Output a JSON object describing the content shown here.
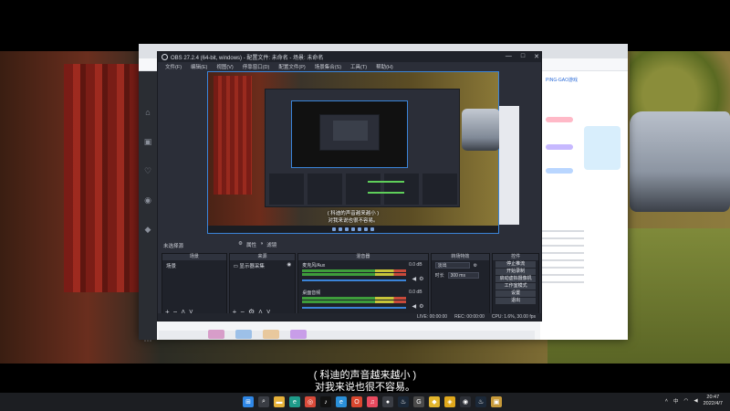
{
  "obs": {
    "title": "OBS 27.2.4 (64-bit, windows) - 配置文件: 未命名 - 场景: 未命名",
    "menu": [
      "文件(F)",
      "编辑(E)",
      "视图(V)",
      "停靠窗口(D)",
      "配置文件(P)",
      "场景集合(S)",
      "工具(T)",
      "帮助(H)"
    ],
    "window_buttons": [
      "—",
      "□",
      "✕"
    ],
    "scene_label": "未选择源",
    "scene_tools": [
      "属性",
      "滤镜"
    ],
    "docks": {
      "scenes_header": "场景",
      "scenes": [
        "场景"
      ],
      "sources_header": "来源",
      "sources": [
        "显示器采集"
      ],
      "mixer_header": "混音器",
      "mixer": [
        {
          "name": "麦克风/Aux",
          "db": "0.0 dB"
        },
        {
          "name": "桌面音频",
          "db": "0.0 dB"
        }
      ],
      "transitions_header": "转场特效",
      "transition_type": "淡出",
      "duration_label": "时长",
      "duration_value": "300 ms",
      "controls_header": "控件",
      "controls": [
        "停止推流",
        "开始录制",
        "启动虚拟摄像机",
        "工作室模式",
        "设置",
        "退出"
      ]
    },
    "status": {
      "live": "LIVE: 00:00:00",
      "rec": "REC: 00:00:00",
      "cpu": "CPU: 1.6%, 30.00 fps"
    },
    "preview_caption": [
      "( 科迪的声音越来越小 )",
      "对我来说也很不容易。"
    ]
  },
  "browser": {
    "left_icons": [
      "home-icon",
      "video-icon",
      "follow-icon",
      "live-icon",
      "game-icon",
      "more-icon"
    ],
    "right_header": "PING-GAO游戏"
  },
  "subtitle": {
    "line1": "( 科迪的声音越来越小 )",
    "line2": "对我来说也很不容易。"
  },
  "taskbar": {
    "icons": [
      "windows-start-icon",
      "search-icon",
      "file-explorer-icon",
      "edge-icon",
      "chrome-icon",
      "tiktok-icon",
      "edge-dev-icon",
      "office-icon",
      "music-icon",
      "obs-icon",
      "steam-icon",
      "game-icon",
      "cheese-icon",
      "shield-icon",
      "obs-studio-icon",
      "steam-2-icon",
      "bag-icon"
    ],
    "tray_lang": "中",
    "time": "20:47",
    "date": "2022/4/7"
  }
}
